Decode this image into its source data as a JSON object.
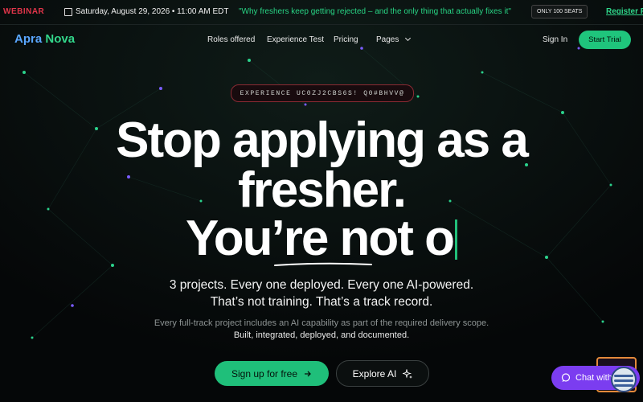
{
  "announcement": {
    "tag": "WEBINAR",
    "date": "Saturday, August 29, 2026 • 11:00 AM EDT",
    "quote": "\"Why freshers keep getting rejected – and the only thing that actually fixes it\"",
    "seats": "ONLY 100 SEATS",
    "register": "Register F"
  },
  "nav": {
    "logo_part1": "Apra",
    "logo_part2": "Nova",
    "items": [
      "Roles offered",
      "Experience Test",
      "Pricing",
      "Pages"
    ],
    "sign_in": "Sign In",
    "cta": "Start Trial"
  },
  "hero": {
    "badge": "EXPERIENCE UC0ZJ2CBS6S! Q0#BHVV@",
    "line1": "Stop applying as a",
    "line2": "fresher.",
    "line3": "You’re not o",
    "sub1": "3 projects. Every one deployed. Every one AI-powered.",
    "sub2": "That’s not training. That’s a track record.",
    "desc1": "Every full-track project includes an AI capability as part of the required delivery scope.",
    "desc2": "Built, integrated, deployed, and documented.",
    "primary_button": "Sign up for free",
    "secondary_button": "Explore AI"
  },
  "chat": {
    "label": "Chat with"
  },
  "colors": {
    "accent_green": "#1fbf7a",
    "logo_blue": "#5aa7ff",
    "webinar_red": "#e0354a",
    "chat_purple": "#7b3df0"
  }
}
